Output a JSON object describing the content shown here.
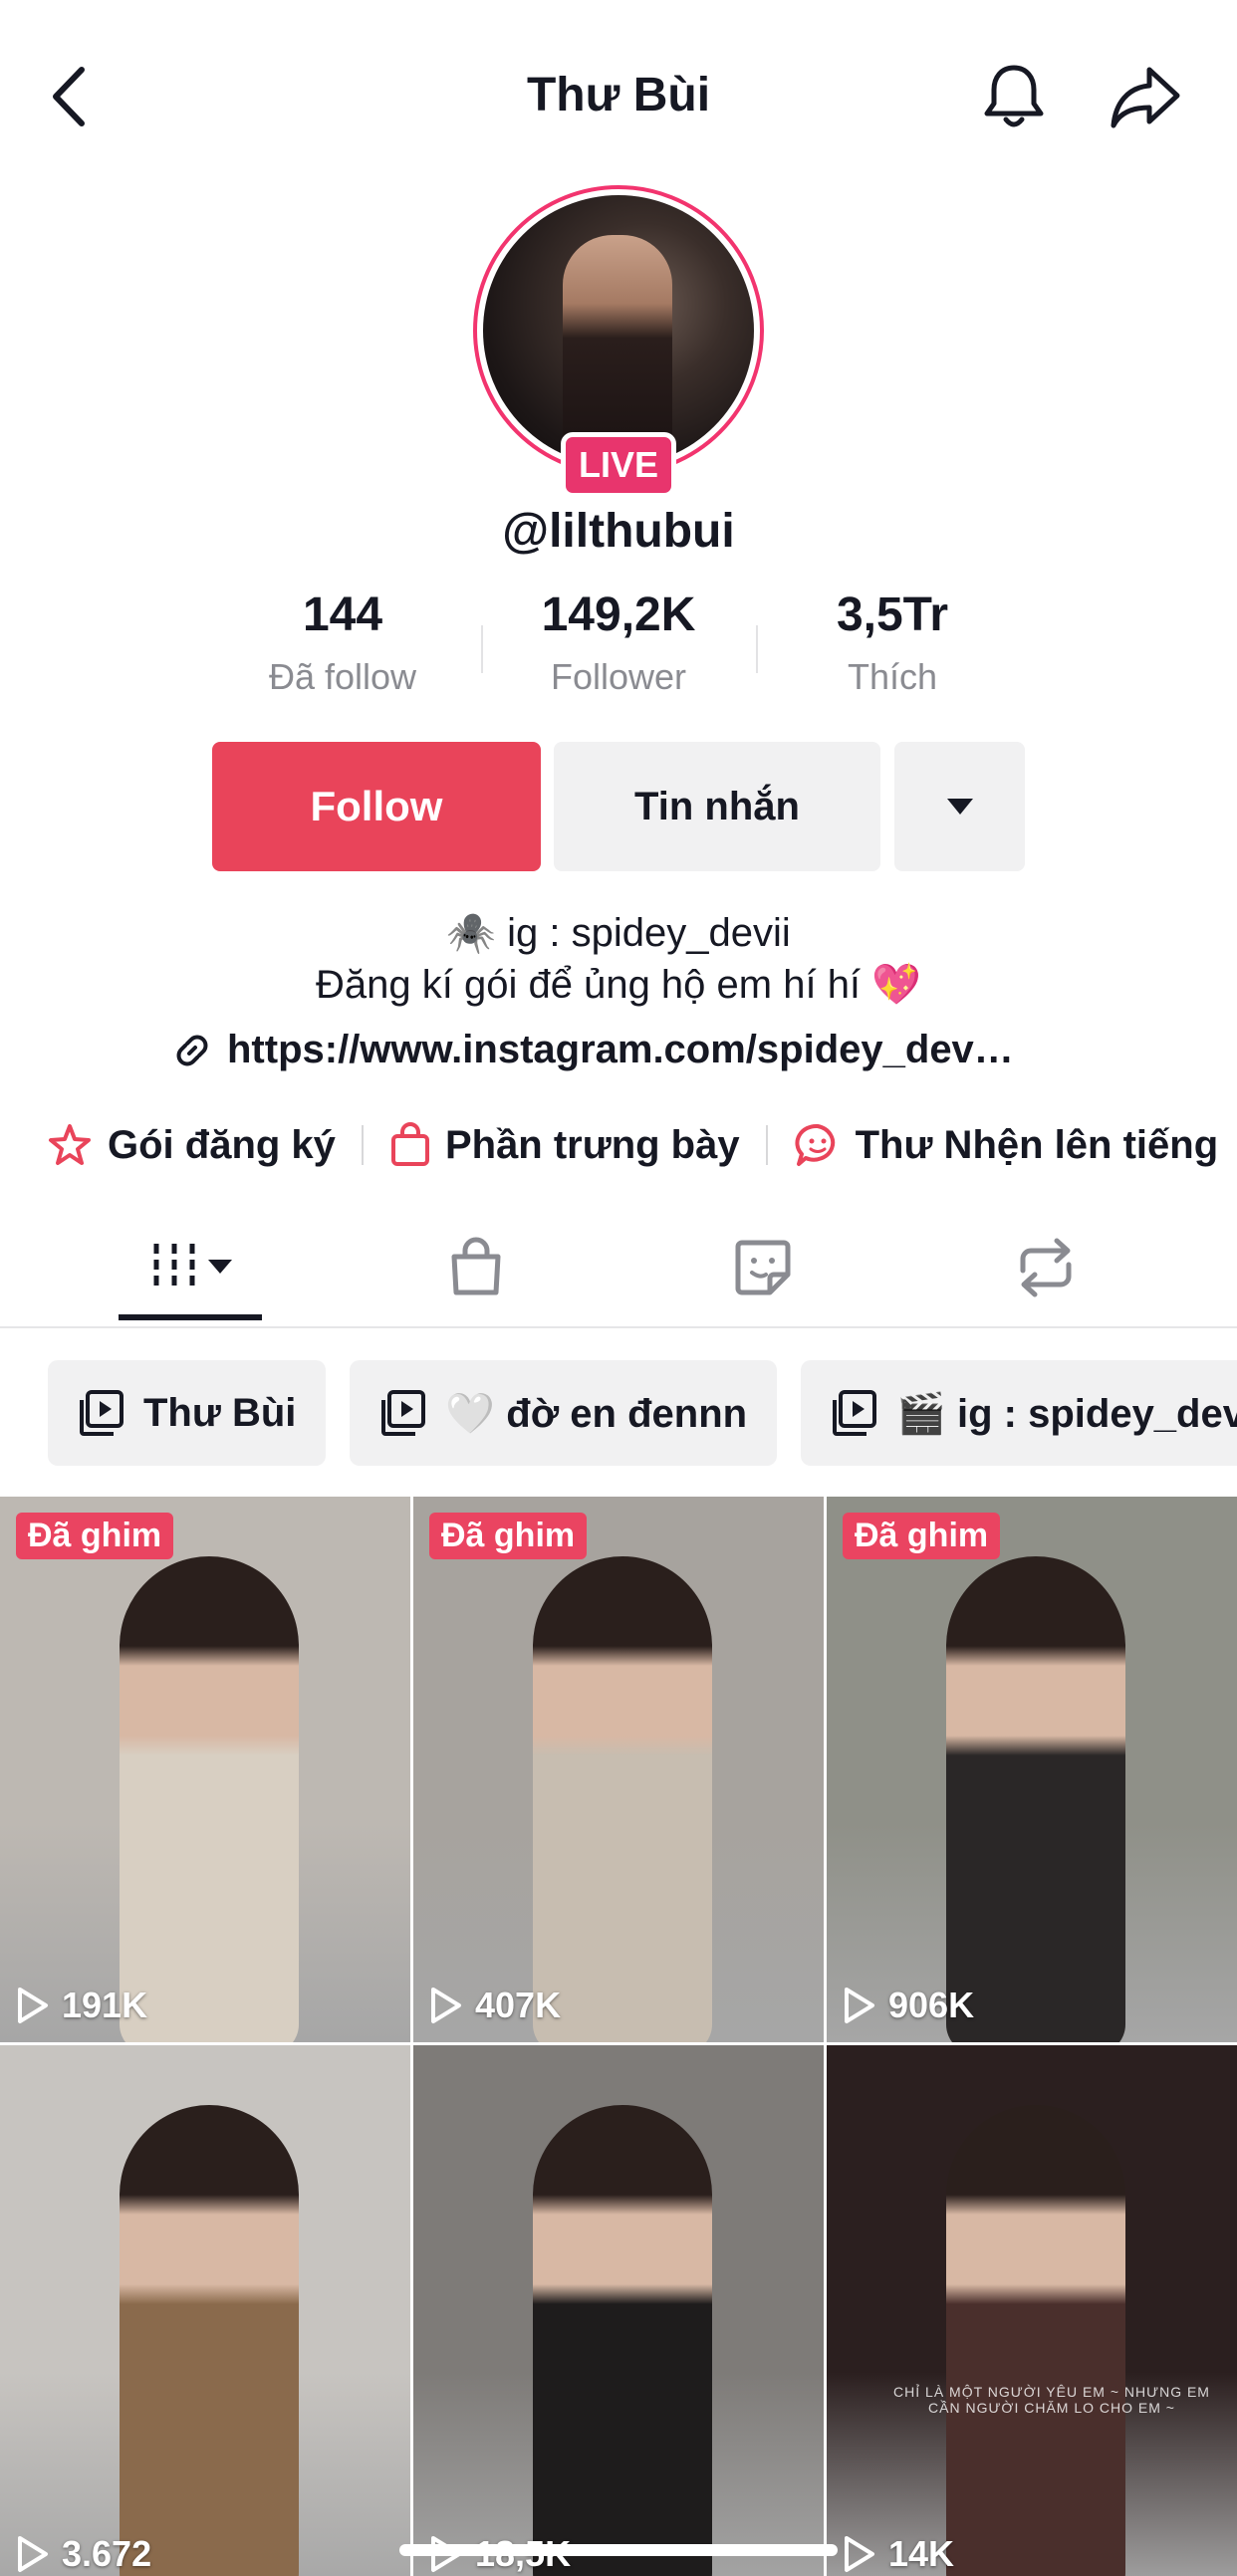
{
  "header": {
    "title": "Thư Bùi",
    "back_icon": "chevron-left-icon",
    "bell_icon": "bell-icon",
    "share_icon": "share-arrow-icon"
  },
  "profile": {
    "live_badge": "LIVE",
    "username": "@lilthubui",
    "stats": [
      {
        "value": "144",
        "label": "Đã follow"
      },
      {
        "value": "149,2K",
        "label": "Follower"
      },
      {
        "value": "3,5Tr",
        "label": "Thích"
      }
    ],
    "actions": {
      "follow": "Follow",
      "message": "Tin nhắn",
      "more_icon": "caret-down-icon"
    },
    "bio": {
      "line1": "🕷️ ig : spidey_devii",
      "line2": "Đăng kí gói để ủng hộ em hí hí 💖",
      "link": "https://www.instagram.com/spidey_dev…"
    },
    "quick_links": [
      {
        "icon": "subscription-star-icon",
        "label": "Gói đăng ký"
      },
      {
        "icon": "shopping-bag-icon",
        "label": "Phần trưng bày"
      },
      {
        "icon": "chat-face-icon",
        "label": "Thư Nhện lên tiếng"
      }
    ]
  },
  "tabs": [
    {
      "icon": "grid-videos-icon",
      "active": true
    },
    {
      "icon": "shop-bag-icon",
      "active": false
    },
    {
      "icon": "sticker-icon",
      "active": false
    },
    {
      "icon": "repost-icon",
      "active": false
    }
  ],
  "playlists": [
    {
      "icon": "playlist-icon",
      "label": "Thư Bùi"
    },
    {
      "icon": "playlist-icon",
      "label": "🤍 đờ en đennn"
    },
    {
      "icon": "playlist-icon",
      "label": "🎬 ig : spidey_devii"
    }
  ],
  "videos": [
    {
      "pinned": "Đã ghim",
      "views": "191K",
      "bg": "#bdb8b2",
      "figure": "#d8cfc2"
    },
    {
      "pinned": "Đã ghim",
      "views": "407K",
      "bg": "#a7a39e",
      "figure": "#c7bdb0"
    },
    {
      "pinned": "Đã ghim",
      "views": "906K",
      "bg": "#8f9088",
      "figure": "#2a2727"
    },
    {
      "pinned": "",
      "views": "3.672",
      "bg": "#c7c4c0",
      "figure": "#8a6a4c"
    },
    {
      "pinned": "",
      "views": "18,5K",
      "bg": "#7e7b78",
      "figure": "#1e1c1c"
    },
    {
      "pinned": "",
      "views": "14K",
      "bg": "#2b1f1f",
      "figure": "#4a2f2c",
      "overlay": "CHỈ LÀ MỘT NGƯỜI YÊU EM ~ NHƯNG EM CẦN NGƯỜI CHĂM LO CHO EM ~"
    }
  ],
  "colors": {
    "accent": "#e9445a",
    "live": "#e8356d",
    "chip_bg": "#f1f1f2",
    "muted_text": "#8a8b91"
  }
}
